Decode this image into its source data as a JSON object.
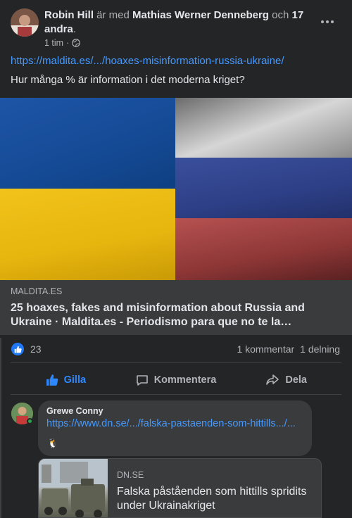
{
  "post": {
    "author": "Robin Hill",
    "with_text": "är med",
    "tagged": "Mathias Werner Denneberg",
    "and_text": "och",
    "others": "17 andra",
    "time": "1 tim",
    "link": "https://maldita.es/.../hoaxes-misinformation-russia-ukraine/",
    "caption": "Hur många % är information i det moderna kriget?"
  },
  "preview": {
    "domain": "MALDITA.ES",
    "title": "25 hoaxes, fakes and misinformation about Russia and Ukraine · Maldita.es - Periodismo para que no te la…"
  },
  "stats": {
    "reactions": "23",
    "comments": "1 kommentar",
    "shares": "1 delning"
  },
  "actions": {
    "like": "Gilla",
    "comment": "Kommentera",
    "share": "Dela"
  },
  "comment": {
    "name": "Grewe Conny",
    "link": "https://www.dn.se/.../falska-pastaenden-som-hittills.../...",
    "emoji": "🐧"
  },
  "comment_preview": {
    "domain": "DN.SE",
    "title": "Falska påståenden som hittills spridits under Ukrainakriget"
  },
  "colors": {
    "link": "#4599ff",
    "like_accent": "#2d88ff",
    "background": "#242526"
  }
}
